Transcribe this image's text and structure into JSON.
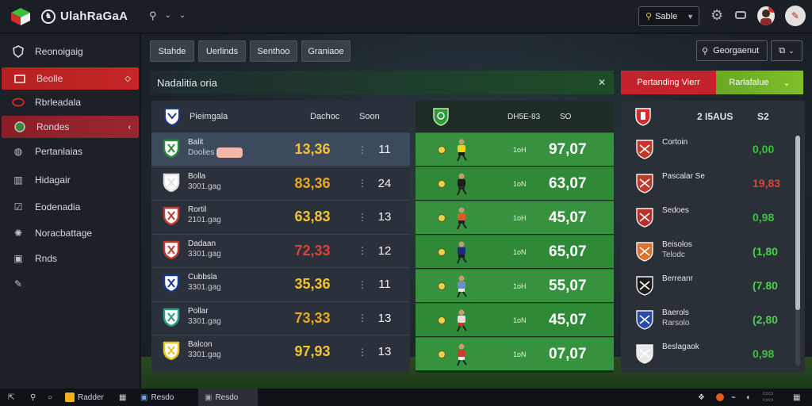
{
  "app": {
    "title": "UlahRaGaA"
  },
  "topbar": {
    "select_label": "Sable"
  },
  "sidebar": {
    "items": [
      {
        "label": "Reonoigaig",
        "icon": "shield-icon"
      },
      {
        "label": "Beolle",
        "icon": "folder-icon"
      },
      {
        "label": "Rbrleadala",
        "icon": "ring-icon"
      },
      {
        "label": "Rondes",
        "icon": "ball-icon"
      },
      {
        "label": "Pertanlaias",
        "icon": "globe-icon"
      },
      {
        "label": "Hidagair",
        "icon": "building-icon"
      },
      {
        "label": "Eodenadia",
        "icon": "check-icon"
      },
      {
        "label": "Noracbattage",
        "icon": "sparkle-icon"
      },
      {
        "label": "Rnds",
        "icon": "monitor-icon"
      },
      {
        "label": "",
        "icon": "pen-icon"
      }
    ]
  },
  "tabs": [
    "Stahde",
    "Uerlinds",
    "Senthoo",
    "Graniaoe"
  ],
  "search": {
    "label": "Georgaenut"
  },
  "banner": {
    "title": "Nadalitia oria"
  },
  "segments": {
    "red": "Pertanding Vierr",
    "green": "Rarlafalue"
  },
  "panel1": {
    "header": {
      "title": "Pieimgala",
      "col1": "Dachoc",
      "col2": "Soon"
    },
    "rows": [
      {
        "team": "Balit",
        "sub": "Doolies",
        "tag": true,
        "odd": "13,36",
        "odd_color": "#f4c430",
        "num": "11"
      },
      {
        "team": "Bolla",
        "sub": "3001.gag",
        "odd": "83,36",
        "odd_color": "#e8a823",
        "num": "24"
      },
      {
        "team": "Rortil",
        "sub": "2101.gag",
        "odd": "63,83",
        "odd_color": "#f4c430",
        "num": "13"
      },
      {
        "team": "Dadaan",
        "sub": "3301.gag",
        "odd": "72,33",
        "odd_color": "#d9443a",
        "num": "12"
      },
      {
        "team": "Cubbsla",
        "sub": "3301.gag",
        "odd": "35,36",
        "odd_color": "#f4c430",
        "num": "11"
      },
      {
        "team": "Pollar",
        "sub": "3301.gag",
        "odd": "73,33",
        "odd_color": "#e8a823",
        "num": "13"
      },
      {
        "team": "Balcon",
        "sub": "3301.gag",
        "odd": "97,93",
        "odd_color": "#f4c430",
        "num": "13"
      }
    ]
  },
  "panel2": {
    "header": {
      "col1": "DH5E-83",
      "col2": "SO"
    },
    "rows": [
      {
        "lbl": "1oH",
        "val": "97,07",
        "shirt": "#f2d21e",
        "shorts": "#1a1a1a"
      },
      {
        "lbl": "1oN",
        "val": "63,07",
        "shirt": "#1c1c1c",
        "shorts": "#2a2a2a"
      },
      {
        "lbl": "1oH",
        "val": "45,07",
        "shirt": "#e05a2a",
        "shorts": "#222"
      },
      {
        "lbl": "1oN",
        "val": "65,07",
        "shirt": "#1b2a7a",
        "shorts": "#1a1a1a"
      },
      {
        "lbl": "1oH",
        "val": "55,07",
        "shirt": "#6a90c4",
        "shorts": "#e8e8e8"
      },
      {
        "lbl": "1oN",
        "val": "45,07",
        "shirt": "#e8e0d8",
        "shorts": "#c0392b"
      },
      {
        "lbl": "1oN",
        "val": "07,07",
        "shirt": "#d63a2a",
        "shorts": "#f0f0f0"
      }
    ]
  },
  "panel3": {
    "header": {
      "col1": "2 I5AUS",
      "col2": "S2"
    },
    "rows": [
      {
        "name": "Cortoin",
        "sub": "",
        "v": "0,00",
        "v_color": "#3ec23e",
        "crest": "#c0392b"
      },
      {
        "name": "Pascalar Se",
        "sub": "",
        "v": "19,83",
        "v_color": "#d9443a",
        "crest": "#c0392b"
      },
      {
        "name": "Sedoes",
        "sub": "",
        "v": "0,98",
        "v_color": "#3ec23e",
        "crest": "#b8302a"
      },
      {
        "name": "Beisolos",
        "sub": "Telodc",
        "v": "(1,80",
        "v_color": "#4ad24a",
        "crest": "#e07030"
      },
      {
        "name": "Berreanr",
        "sub": "",
        "v": "(7.80",
        "v_color": "#4ad24a",
        "crest": "#1c1c1c"
      },
      {
        "name": "Baerols",
        "sub": "Rarsolo",
        "v": "(2,80",
        "v_color": "#4ad24a",
        "crest": "#2a4aa8"
      },
      {
        "name": "Beslagaok",
        "sub": "",
        "v": "0,98",
        "v_color": "#3ec23e",
        "crest": "#e8e8e8"
      }
    ]
  },
  "taskbar": {
    "app1": "Radder",
    "app2": "Resdo",
    "app3": "Resdo"
  }
}
